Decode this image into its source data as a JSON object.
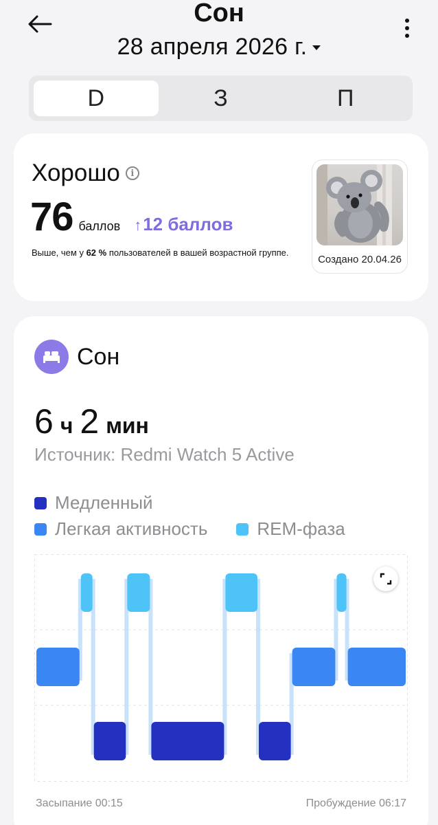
{
  "header": {
    "title": "Сон",
    "date": "28 апреля 2026 г."
  },
  "tabs": [
    {
      "label": "D",
      "active": true
    },
    {
      "label": "З",
      "active": false
    },
    {
      "label": "П",
      "active": false
    }
  ],
  "score_card": {
    "quality": "Хорошо",
    "info_glyph": "i",
    "score": "76",
    "score_unit": "баллов",
    "delta_arrow": "↑",
    "delta": "12 баллов",
    "desc_prefix": "Выше, чем у ",
    "desc_percent": "62 %",
    "desc_suffix": " пользователей в вашей возрастной группе.",
    "badge_caption": "Создано 20.04.26",
    "accent_color": "#7e6dde"
  },
  "sleep_card": {
    "title": "Сон",
    "hours": "6",
    "hours_unit": "ч",
    "minutes": "2",
    "minutes_unit": "мин",
    "source": "Источник: Redmi Watch 5 Active",
    "legend": [
      {
        "label": "Медленный",
        "color": "#2431c0"
      },
      {
        "label": "Легкая активность",
        "color": "#3a87f3"
      },
      {
        "label": "REM-фаза",
        "color": "#4ec3f7"
      }
    ],
    "sleep_start": "Засыпание 00:15",
    "wake_up": "Пробуждение 06:17",
    "icon_color": "#8c7ae6"
  },
  "chart_data": {
    "type": "hypnogram",
    "levels": [
      "REM-фаза",
      "Легкая активность",
      "Медленный"
    ],
    "x_start": "00:15",
    "x_end": "06:17",
    "segments": [
      {
        "stage": "Легкая активность",
        "start": 0.0,
        "end": 0.12
      },
      {
        "stage": "REM-фаза",
        "start": 0.12,
        "end": 0.155
      },
      {
        "stage": "Медленный",
        "start": 0.155,
        "end": 0.245
      },
      {
        "stage": "REM-фаза",
        "start": 0.245,
        "end": 0.31
      },
      {
        "stage": "Медленный",
        "start": 0.31,
        "end": 0.51
      },
      {
        "stage": "REM-фаза",
        "start": 0.51,
        "end": 0.6
      },
      {
        "stage": "Медленный",
        "start": 0.6,
        "end": 0.69
      },
      {
        "stage": "Легкая активность",
        "start": 0.69,
        "end": 0.81
      },
      {
        "stage": "REM-фаза",
        "start": 0.81,
        "end": 0.84
      },
      {
        "stage": "Легкая активность",
        "start": 0.84,
        "end": 1.0
      }
    ]
  }
}
